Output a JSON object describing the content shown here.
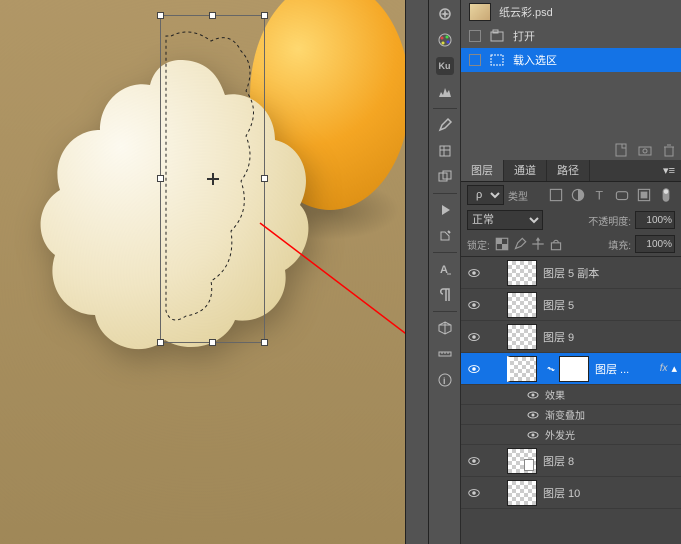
{
  "history": {
    "doc_name": "纸云彩.psd",
    "items": [
      {
        "label": "打开"
      },
      {
        "label": "载入选区"
      }
    ]
  },
  "layers_panel": {
    "tabs": {
      "layers": "图层",
      "channels": "通道",
      "paths": "路径"
    },
    "kind_label": "类型",
    "blend_mode": "正常",
    "opacity_label": "不透明度:",
    "opacity_value": "100%",
    "lock_label": "锁定:",
    "fill_label": "填充:",
    "fill_value": "100%",
    "effects_label": "效果",
    "gradient_overlay_label": "渐变叠加",
    "outer_glow_label": "外发光",
    "layers": [
      {
        "name": "图层 5 副本",
        "transparent": true
      },
      {
        "name": "图层 5",
        "transparent": true
      },
      {
        "name": "图层 9",
        "transparent": true
      },
      {
        "name": "图层 ...",
        "transparent": true,
        "selected": true,
        "has_mask": true,
        "has_fx": true
      },
      {
        "name": "图层 8",
        "transparent": true,
        "thumb_white": true
      },
      {
        "name": "图层 10",
        "transparent": true
      }
    ]
  }
}
